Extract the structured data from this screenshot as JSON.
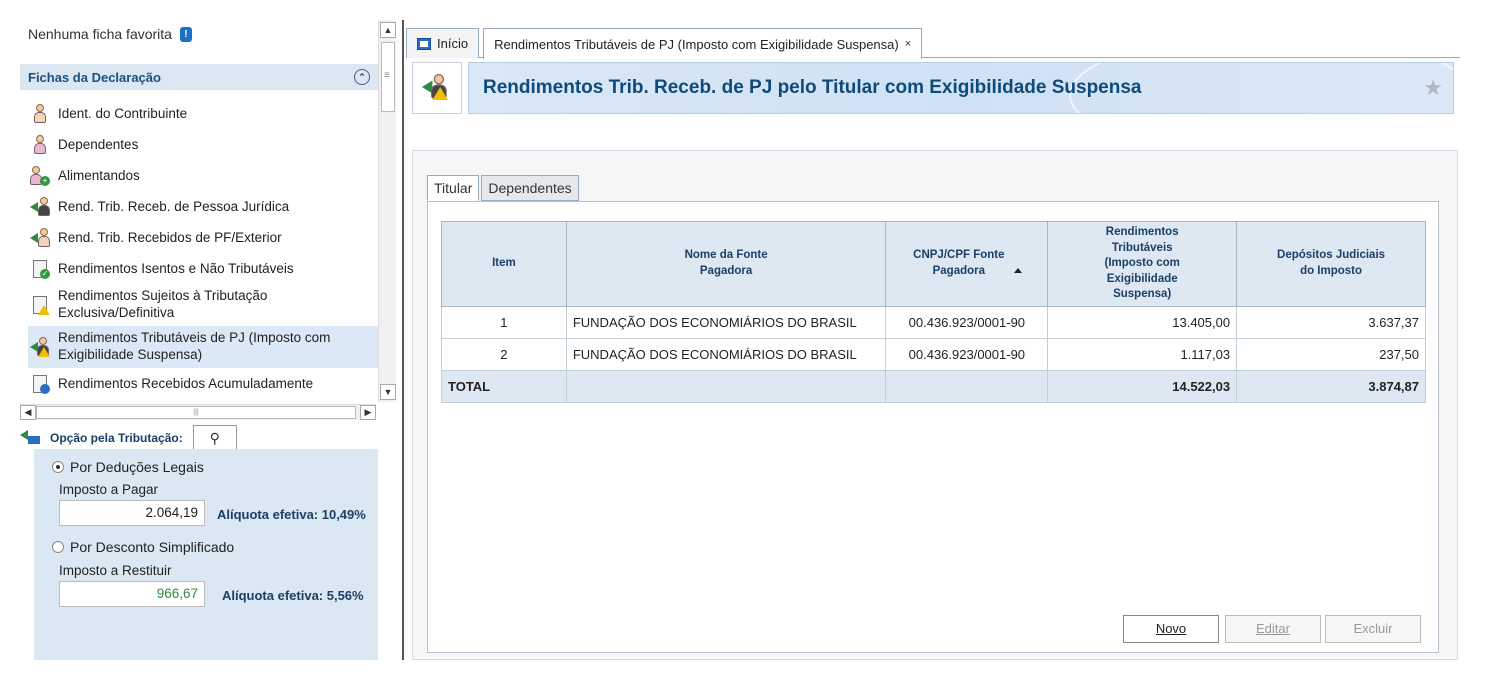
{
  "left": {
    "favorites_text": "Nenhuma ficha favorita",
    "fichas_header": "Fichas da Declaração",
    "fichas": [
      {
        "label": "Ident. do Contribuinte",
        "icon": "person-icon"
      },
      {
        "label": "Dependentes",
        "icon": "dependents-icon"
      },
      {
        "label": "Alimentandos",
        "icon": "alimentandos-icon"
      },
      {
        "label": "Rend. Trib. Receb. de Pessoa Jurídica",
        "icon": "income-pj-icon"
      },
      {
        "label": "Rend. Trib. Recebidos de PF/Exterior",
        "icon": "income-pf-icon"
      },
      {
        "label": "Rendimentos Isentos e Não Tributáveis",
        "icon": "exempt-income-icon"
      },
      {
        "label": "Rendimentos Sujeitos à Tributação Exclusiva/Definitiva",
        "icon": "exclusive-tax-icon"
      },
      {
        "label": "Rendimentos Tributáveis de PJ (Imposto com Exigibilidade Suspensa)",
        "icon": "suspended-tax-icon"
      },
      {
        "label": "Rendimentos Recebidos Acumuladamente",
        "icon": "accumulated-income-icon"
      }
    ],
    "opcao_label": "Opção pela Tributação:",
    "deducoes_label": "Por Deduções Legais",
    "imposto_pagar_label": "Imposto a Pagar",
    "imposto_pagar_value": "2.064,19",
    "aliquota1": "Alíquota efetiva: 10,49%",
    "simplificado_label": "Por Desconto Simplificado",
    "imposto_restituir_label": "Imposto a Restituir",
    "imposto_restituir_value": "966,67",
    "aliquota2": "Alíquota efetiva: 5,56%",
    "restituir_color": "#2e8b3e"
  },
  "tabs": {
    "home": "Início",
    "active": "Rendimentos Tributáveis de PJ (Imposto com Exigibilidade Suspensa)",
    "close": "×"
  },
  "header": {
    "title": "Rendimentos Trib. Receb. de PJ pelo Titular com Exigibilidade Suspensa",
    "star": "★"
  },
  "inner_tabs": [
    "Titular",
    "Dependentes"
  ],
  "table": {
    "columns": [
      "Item",
      "Nome da Fonte Pagadora",
      "CNPJ/CPF Fonte Pagadora",
      "Rendimentos Tributáveis (Imposto com Exigibilidade Suspensa)",
      "Depósitos Judiciais do Imposto"
    ],
    "rows": [
      {
        "item": "1",
        "nome": "FUNDAÇÃO DOS ECONOMIÁRIOS DO BRASIL",
        "cnpj": "00.436.923/0001-90",
        "rendimentos": "13.405,00",
        "depositos": "3.637,37"
      },
      {
        "item": "2",
        "nome": "FUNDAÇÃO DOS ECONOMIÁRIOS DO BRASIL",
        "cnpj": "00.436.923/0001-90",
        "rendimentos": "1.117,03",
        "depositos": "237,50"
      }
    ],
    "total_label": "TOTAL",
    "total_rendimentos": "14.522,03",
    "total_depositos": "3.874,87"
  },
  "buttons": {
    "novo": "Novo",
    "editar": "Editar",
    "excluir": "Excluir"
  }
}
